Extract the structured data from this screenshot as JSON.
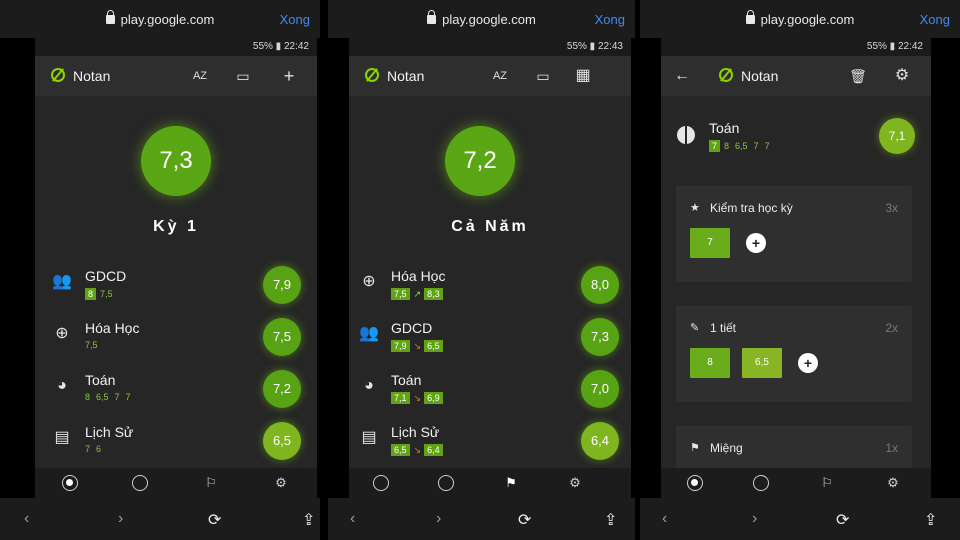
{
  "browser": {
    "url": "play.google.com",
    "done_label": "Xong",
    "nav": {
      "back": "‹",
      "forward": "›",
      "reload": "⟳",
      "share": "⇪"
    }
  },
  "app": {
    "name": "Notan"
  },
  "colors": {
    "accent_green": "#5aa716",
    "score_yellow_green": "#7fb51f",
    "background": "#262626",
    "link_blue": "#3d8df0"
  },
  "screen1": {
    "status": "55% ▮ 22:42",
    "toolbar": {
      "sort_icon": "AZ",
      "ruler_icon": "▭",
      "add_icon": "+"
    },
    "average": "7,3",
    "term_label": "Kỳ 1",
    "subjects": [
      {
        "name": "GDCD",
        "icon": "people-icon",
        "grades": [
          "8",
          "7,5"
        ],
        "score": "7,9"
      },
      {
        "name": "Hóa Học",
        "icon": "atom-icon",
        "grades": [
          "7,5"
        ],
        "score": "7,5"
      },
      {
        "name": "Toán",
        "icon": "pie-icon",
        "grades": [
          "8",
          "6,5",
          "7",
          "7"
        ],
        "score": "7,2"
      },
      {
        "name": "Lịch Sử",
        "icon": "book-icon",
        "grades": [
          "7",
          "6"
        ],
        "score": "6,5"
      }
    ]
  },
  "screen2": {
    "status": "55% ▮ 22:43",
    "toolbar": {
      "sort_icon": "AZ",
      "ruler_icon": "▭",
      "grid_icon": "▦"
    },
    "average": "7,2",
    "term_label": "Cả Năm",
    "subjects": [
      {
        "name": "Hóa Học",
        "icon": "atom-icon",
        "from": "7,5",
        "to": "8,3",
        "trend": "up",
        "score": "8,0"
      },
      {
        "name": "GDCD",
        "icon": "people-icon",
        "from": "7,9",
        "to": "6,5",
        "trend": "down",
        "score": "7,3"
      },
      {
        "name": "Toán",
        "icon": "pie-icon",
        "from": "7,1",
        "to": "6,9",
        "trend": "down",
        "score": "7,0"
      },
      {
        "name": "Lịch Sử",
        "icon": "book-icon",
        "from": "6,5",
        "to": "6,4",
        "trend": "down",
        "score": "6,4"
      }
    ]
  },
  "screen3": {
    "status": "55% ▮ 22:42",
    "subject": "Toán",
    "grades": [
      "7",
      "8",
      "6,5",
      "7",
      "7"
    ],
    "score": "7,1",
    "categories": [
      {
        "icon": "star-icon",
        "title": "Kiểm tra học kỳ",
        "weight": "3x",
        "grades": [
          "7"
        ]
      },
      {
        "icon": "pencil-icon",
        "title": "1 tiết",
        "weight": "2x",
        "grades": [
          "8",
          "6,5"
        ]
      },
      {
        "icon": "flag-icon",
        "title": "Miệng",
        "weight": "1x",
        "grades": []
      }
    ]
  }
}
